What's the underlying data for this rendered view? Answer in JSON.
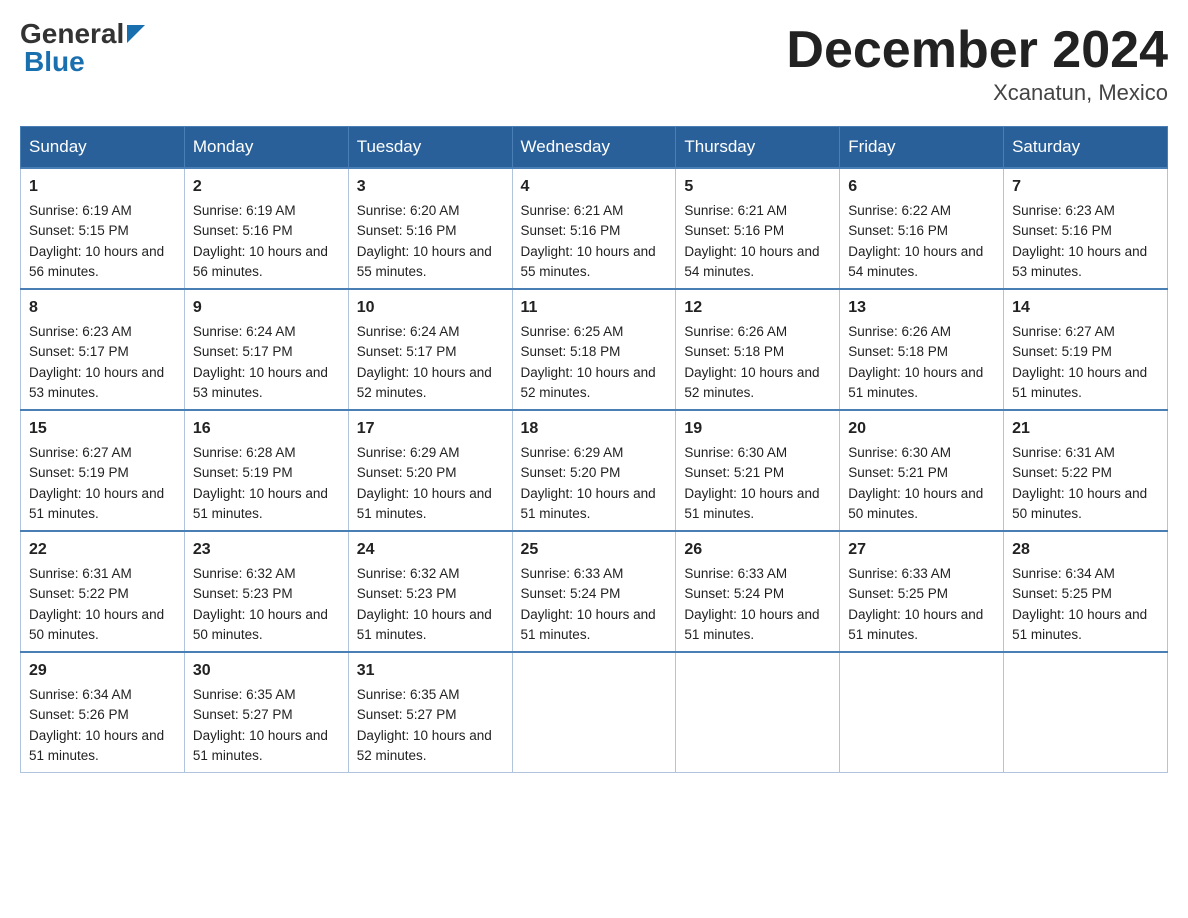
{
  "header": {
    "month_title": "December 2024",
    "location": "Xcanatun, Mexico",
    "logo_general": "General",
    "logo_blue": "Blue"
  },
  "days_of_week": [
    "Sunday",
    "Monday",
    "Tuesday",
    "Wednesday",
    "Thursday",
    "Friday",
    "Saturday"
  ],
  "weeks": [
    [
      {
        "day": "1",
        "sunrise": "6:19 AM",
        "sunset": "5:15 PM",
        "daylight": "10 hours and 56 minutes."
      },
      {
        "day": "2",
        "sunrise": "6:19 AM",
        "sunset": "5:16 PM",
        "daylight": "10 hours and 56 minutes."
      },
      {
        "day": "3",
        "sunrise": "6:20 AM",
        "sunset": "5:16 PM",
        "daylight": "10 hours and 55 minutes."
      },
      {
        "day": "4",
        "sunrise": "6:21 AM",
        "sunset": "5:16 PM",
        "daylight": "10 hours and 55 minutes."
      },
      {
        "day": "5",
        "sunrise": "6:21 AM",
        "sunset": "5:16 PM",
        "daylight": "10 hours and 54 minutes."
      },
      {
        "day": "6",
        "sunrise": "6:22 AM",
        "sunset": "5:16 PM",
        "daylight": "10 hours and 54 minutes."
      },
      {
        "day": "7",
        "sunrise": "6:23 AM",
        "sunset": "5:16 PM",
        "daylight": "10 hours and 53 minutes."
      }
    ],
    [
      {
        "day": "8",
        "sunrise": "6:23 AM",
        "sunset": "5:17 PM",
        "daylight": "10 hours and 53 minutes."
      },
      {
        "day": "9",
        "sunrise": "6:24 AM",
        "sunset": "5:17 PM",
        "daylight": "10 hours and 53 minutes."
      },
      {
        "day": "10",
        "sunrise": "6:24 AM",
        "sunset": "5:17 PM",
        "daylight": "10 hours and 52 minutes."
      },
      {
        "day": "11",
        "sunrise": "6:25 AM",
        "sunset": "5:18 PM",
        "daylight": "10 hours and 52 minutes."
      },
      {
        "day": "12",
        "sunrise": "6:26 AM",
        "sunset": "5:18 PM",
        "daylight": "10 hours and 52 minutes."
      },
      {
        "day": "13",
        "sunrise": "6:26 AM",
        "sunset": "5:18 PM",
        "daylight": "10 hours and 51 minutes."
      },
      {
        "day": "14",
        "sunrise": "6:27 AM",
        "sunset": "5:19 PM",
        "daylight": "10 hours and 51 minutes."
      }
    ],
    [
      {
        "day": "15",
        "sunrise": "6:27 AM",
        "sunset": "5:19 PM",
        "daylight": "10 hours and 51 minutes."
      },
      {
        "day": "16",
        "sunrise": "6:28 AM",
        "sunset": "5:19 PM",
        "daylight": "10 hours and 51 minutes."
      },
      {
        "day": "17",
        "sunrise": "6:29 AM",
        "sunset": "5:20 PM",
        "daylight": "10 hours and 51 minutes."
      },
      {
        "day": "18",
        "sunrise": "6:29 AM",
        "sunset": "5:20 PM",
        "daylight": "10 hours and 51 minutes."
      },
      {
        "day": "19",
        "sunrise": "6:30 AM",
        "sunset": "5:21 PM",
        "daylight": "10 hours and 51 minutes."
      },
      {
        "day": "20",
        "sunrise": "6:30 AM",
        "sunset": "5:21 PM",
        "daylight": "10 hours and 50 minutes."
      },
      {
        "day": "21",
        "sunrise": "6:31 AM",
        "sunset": "5:22 PM",
        "daylight": "10 hours and 50 minutes."
      }
    ],
    [
      {
        "day": "22",
        "sunrise": "6:31 AM",
        "sunset": "5:22 PM",
        "daylight": "10 hours and 50 minutes."
      },
      {
        "day": "23",
        "sunrise": "6:32 AM",
        "sunset": "5:23 PM",
        "daylight": "10 hours and 50 minutes."
      },
      {
        "day": "24",
        "sunrise": "6:32 AM",
        "sunset": "5:23 PM",
        "daylight": "10 hours and 51 minutes."
      },
      {
        "day": "25",
        "sunrise": "6:33 AM",
        "sunset": "5:24 PM",
        "daylight": "10 hours and 51 minutes."
      },
      {
        "day": "26",
        "sunrise": "6:33 AM",
        "sunset": "5:24 PM",
        "daylight": "10 hours and 51 minutes."
      },
      {
        "day": "27",
        "sunrise": "6:33 AM",
        "sunset": "5:25 PM",
        "daylight": "10 hours and 51 minutes."
      },
      {
        "day": "28",
        "sunrise": "6:34 AM",
        "sunset": "5:25 PM",
        "daylight": "10 hours and 51 minutes."
      }
    ],
    [
      {
        "day": "29",
        "sunrise": "6:34 AM",
        "sunset": "5:26 PM",
        "daylight": "10 hours and 51 minutes."
      },
      {
        "day": "30",
        "sunrise": "6:35 AM",
        "sunset": "5:27 PM",
        "daylight": "10 hours and 51 minutes."
      },
      {
        "day": "31",
        "sunrise": "6:35 AM",
        "sunset": "5:27 PM",
        "daylight": "10 hours and 52 minutes."
      },
      null,
      null,
      null,
      null
    ]
  ]
}
